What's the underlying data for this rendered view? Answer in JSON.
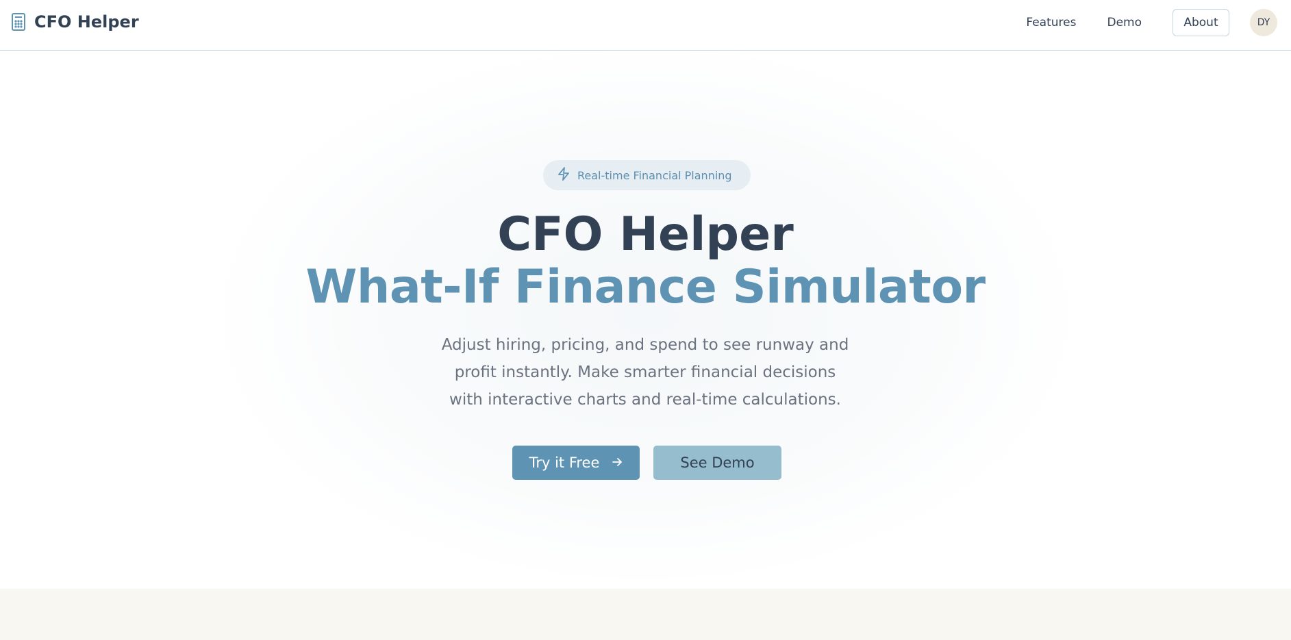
{
  "colors": {
    "accent": "#5f93b3",
    "accent_light": "#96bdcd",
    "text_dark": "#334155",
    "text_muted": "#6b7280",
    "lower_bg": "#f8f7f2"
  },
  "nav": {
    "brand_icon": "calculator-icon",
    "brand_name": "CFO Helper",
    "links": {
      "features": "Features",
      "demo": "Demo",
      "about": "About"
    },
    "avatar_initials": "DY"
  },
  "hero": {
    "badge_icon": "lightning-icon",
    "badge_text": "Real-time Financial Planning",
    "title_line1": "CFO Helper",
    "title_line2": "What-If Finance Simulator",
    "subtitle_lines": [
      "Adjust hiring, pricing, and spend to see runway and",
      "profit instantly. Make smarter financial decisions",
      "with interactive charts and real-time calculations."
    ],
    "primary_button": "Try it Free",
    "primary_button_icon": "arrow-right-icon",
    "secondary_button": "See Demo"
  }
}
